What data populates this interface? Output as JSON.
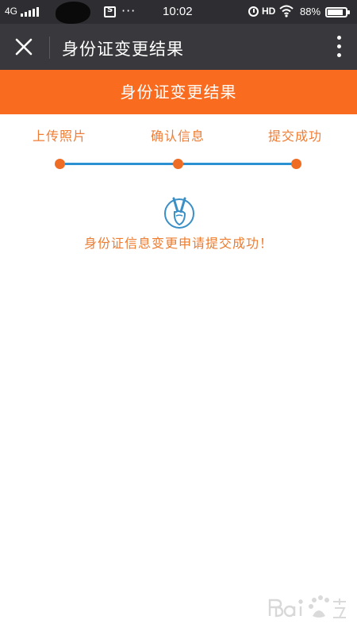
{
  "status_bar": {
    "network": "4G",
    "time": "10:02",
    "hd": "HD",
    "battery": "88%",
    "icons": [
      "signal-icon",
      "screenshot-icon",
      "more-icon",
      "alarm-icon",
      "wifi-icon",
      "battery-icon"
    ]
  },
  "title_bar": {
    "title": "身份证变更结果",
    "icons": [
      "close-icon",
      "more-vertical-icon"
    ]
  },
  "banner": {
    "title": "身份证变更结果"
  },
  "steps": [
    {
      "label": "上传照片"
    },
    {
      "label": "确认信息"
    },
    {
      "label": "提交成功"
    }
  ],
  "result": {
    "icon": "victory-hand-icon",
    "message": "身份证信息变更申请提交成功！"
  },
  "colors": {
    "status_bar": "#2e2e32",
    "title_bar": "#39393d",
    "banner": "#f96b1f",
    "step_text": "#ef7c34",
    "step_dot": "#ee6c24",
    "step_line": "#2b91d2",
    "icon": "#3a8fc6"
  }
}
